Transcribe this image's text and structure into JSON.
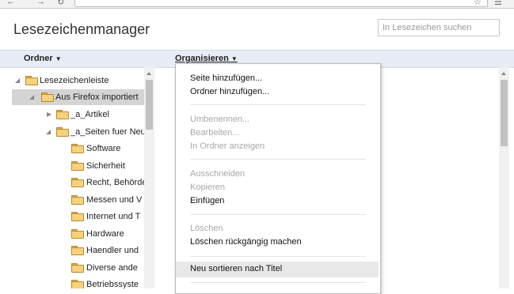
{
  "page": {
    "title": "Lesezeichenmanager",
    "search_placeholder": "In Lesezeichen suchen"
  },
  "toolbar": {
    "folders_label": "Ordner",
    "organize_label": "Organisieren"
  },
  "tree": [
    {
      "label": "Lesezeichenleiste",
      "expanded": true,
      "selected": false
    },
    {
      "label": "Aus Firefox importiert",
      "expanded": true,
      "selected": true
    },
    {
      "label": "_a_Artikel",
      "expanded": false,
      "selected": false
    },
    {
      "label": "_a_Seiten fuer Neu",
      "expanded": true,
      "selected": false
    },
    {
      "label": "Software"
    },
    {
      "label": "Sicherheit"
    },
    {
      "label": "Recht, Behörde"
    },
    {
      "label": "Messen und V"
    },
    {
      "label": "Internet und T"
    },
    {
      "label": "Hardware"
    },
    {
      "label": "Haendler und"
    },
    {
      "label": "Diverse ande"
    },
    {
      "label": "Betriebssyste"
    }
  ],
  "organize_menu": {
    "items": [
      {
        "label": "Seite hinzufügen...",
        "enabled": true
      },
      {
        "label": "Ordner hinzufügen...",
        "enabled": true
      },
      {
        "label": "Umbenennen...",
        "enabled": false
      },
      {
        "label": "Bearbeiten...",
        "enabled": false
      },
      {
        "label": "In Ordner anzeigen",
        "enabled": false
      },
      {
        "label": "Ausschneiden",
        "enabled": false
      },
      {
        "label": "Kopieren",
        "enabled": false
      },
      {
        "label": "Einfügen",
        "enabled": true
      },
      {
        "label": "Löschen",
        "enabled": false
      },
      {
        "label": "Löschen rückgängig machen",
        "enabled": true
      },
      {
        "label": "Neu sortieren nach Titel",
        "enabled": true,
        "highlighted": true
      }
    ]
  },
  "colors": {
    "toolbar_bg": "#e8edf5",
    "selected_row": "#d4d4d4",
    "folder": "#f7d27c",
    "disabled_text": "#a8a8a8"
  }
}
